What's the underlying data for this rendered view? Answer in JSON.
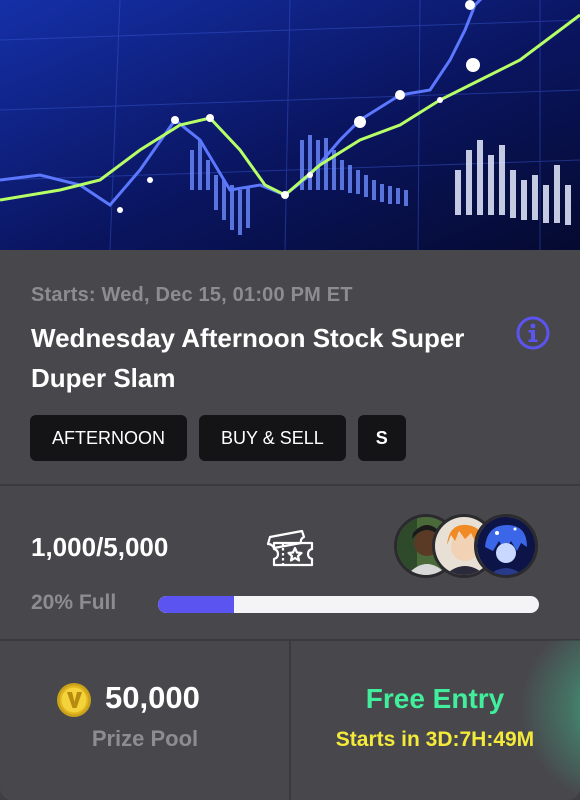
{
  "event": {
    "starts": "Starts: Wed, Dec 15, 01:00 PM ET",
    "title": "Wednesday Afternoon Stock Super Duper Slam",
    "tags": [
      "AFTERNOON",
      "BUY & SELL",
      "S"
    ]
  },
  "entries": {
    "count_label": "1,000/5,000",
    "fill_label": "20% Full",
    "fill_fraction": 0.2
  },
  "prize": {
    "amount": "50,000",
    "label": "Prize Pool"
  },
  "entry": {
    "type": "Free Entry",
    "countdown": "Starts in 3D:7H:49M"
  },
  "icons": {
    "info": "info-icon",
    "ticket": "ticket-icon",
    "coin": "coin-icon"
  },
  "colors": {
    "accent": "#5b54f0",
    "free_entry": "#41ee9b",
    "countdown": "#f4ea39"
  }
}
